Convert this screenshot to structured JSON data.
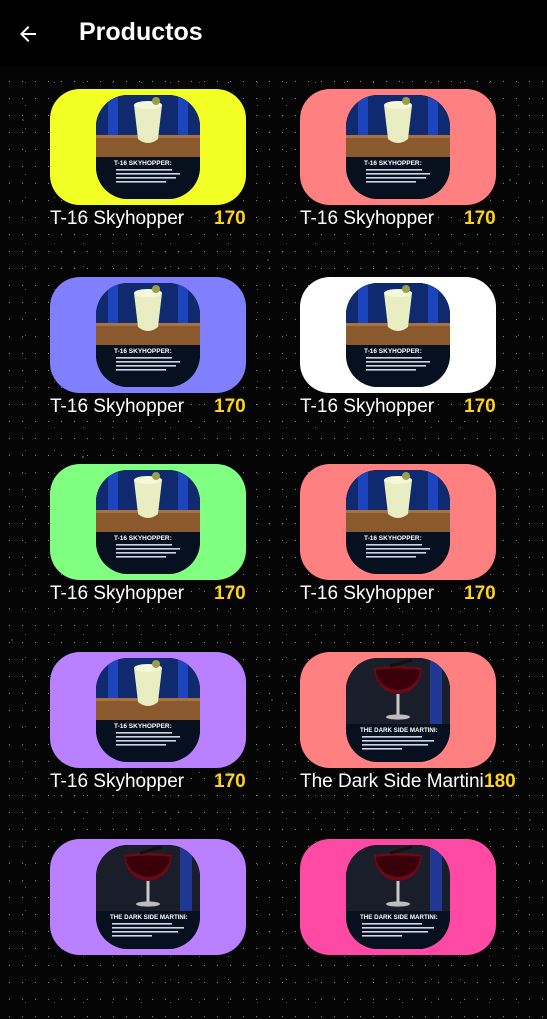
{
  "appbar": {
    "title": "Productos",
    "back_icon": "arrow-left-icon"
  },
  "products": [
    {
      "name": "T-16 Skyhopper",
      "price": "170",
      "color": "#f2ff24",
      "photo": "skyhopper",
      "photo_title": "T-16 SKYHOPPER:"
    },
    {
      "name": "T-16 Skyhopper",
      "price": "170",
      "color": "#ff8080",
      "photo": "skyhopper",
      "photo_title": "T-16 SKYHOPPER:"
    },
    {
      "name": "T-16 Skyhopper",
      "price": "170",
      "color": "#8080ff",
      "photo": "skyhopper",
      "photo_title": "T-16 SKYHOPPER:"
    },
    {
      "name": "T-16 Skyhopper",
      "price": "170",
      "color": "#ffffff",
      "photo": "skyhopper",
      "photo_title": "T-16 SKYHOPPER:"
    },
    {
      "name": "T-16 Skyhopper",
      "price": "170",
      "color": "#80ff80",
      "photo": "skyhopper",
      "photo_title": "T-16 SKYHOPPER:"
    },
    {
      "name": "T-16 Skyhopper",
      "price": "170",
      "color": "#ff8080",
      "photo": "skyhopper",
      "photo_title": "T-16 SKYHOPPER:"
    },
    {
      "name": "T-16 Skyhopper",
      "price": "170",
      "color": "#b980ff",
      "photo": "skyhopper",
      "photo_title": "T-16 SKYHOPPER:"
    },
    {
      "name": "The Dark Side Martini",
      "price": "180",
      "color": "#ff8080",
      "photo": "martini",
      "photo_title": "THE DARK SIDE MARTINI:"
    },
    {
      "name": "",
      "price": "",
      "color": "#b980ff",
      "photo": "martini",
      "photo_title": "THE DARK SIDE MARTINI:"
    },
    {
      "name": "",
      "price": "",
      "color": "#ff4aa5",
      "photo": "martini",
      "photo_title": "THE DARK SIDE MARTINI:"
    }
  ]
}
